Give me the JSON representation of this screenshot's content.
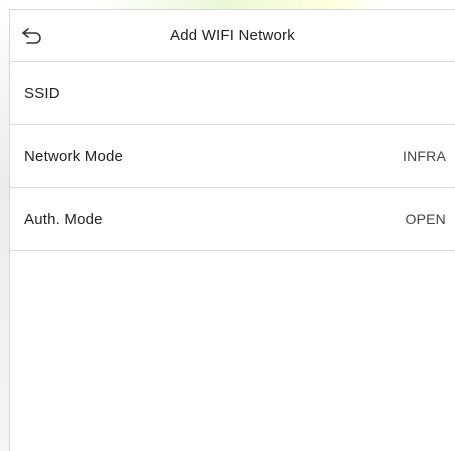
{
  "header": {
    "back_icon": "back-arrow-icon",
    "title": "Add WIFI Network"
  },
  "settings": {
    "items": [
      {
        "label": "SSID",
        "value": ""
      },
      {
        "label": "Network Mode",
        "value": "INFRA"
      },
      {
        "label": "Auth. Mode",
        "value": "OPEN"
      }
    ]
  },
  "colors": {
    "background": "#ffffff",
    "divider": "#dcdcdc",
    "text": "#222222",
    "value_text": "#444444"
  }
}
